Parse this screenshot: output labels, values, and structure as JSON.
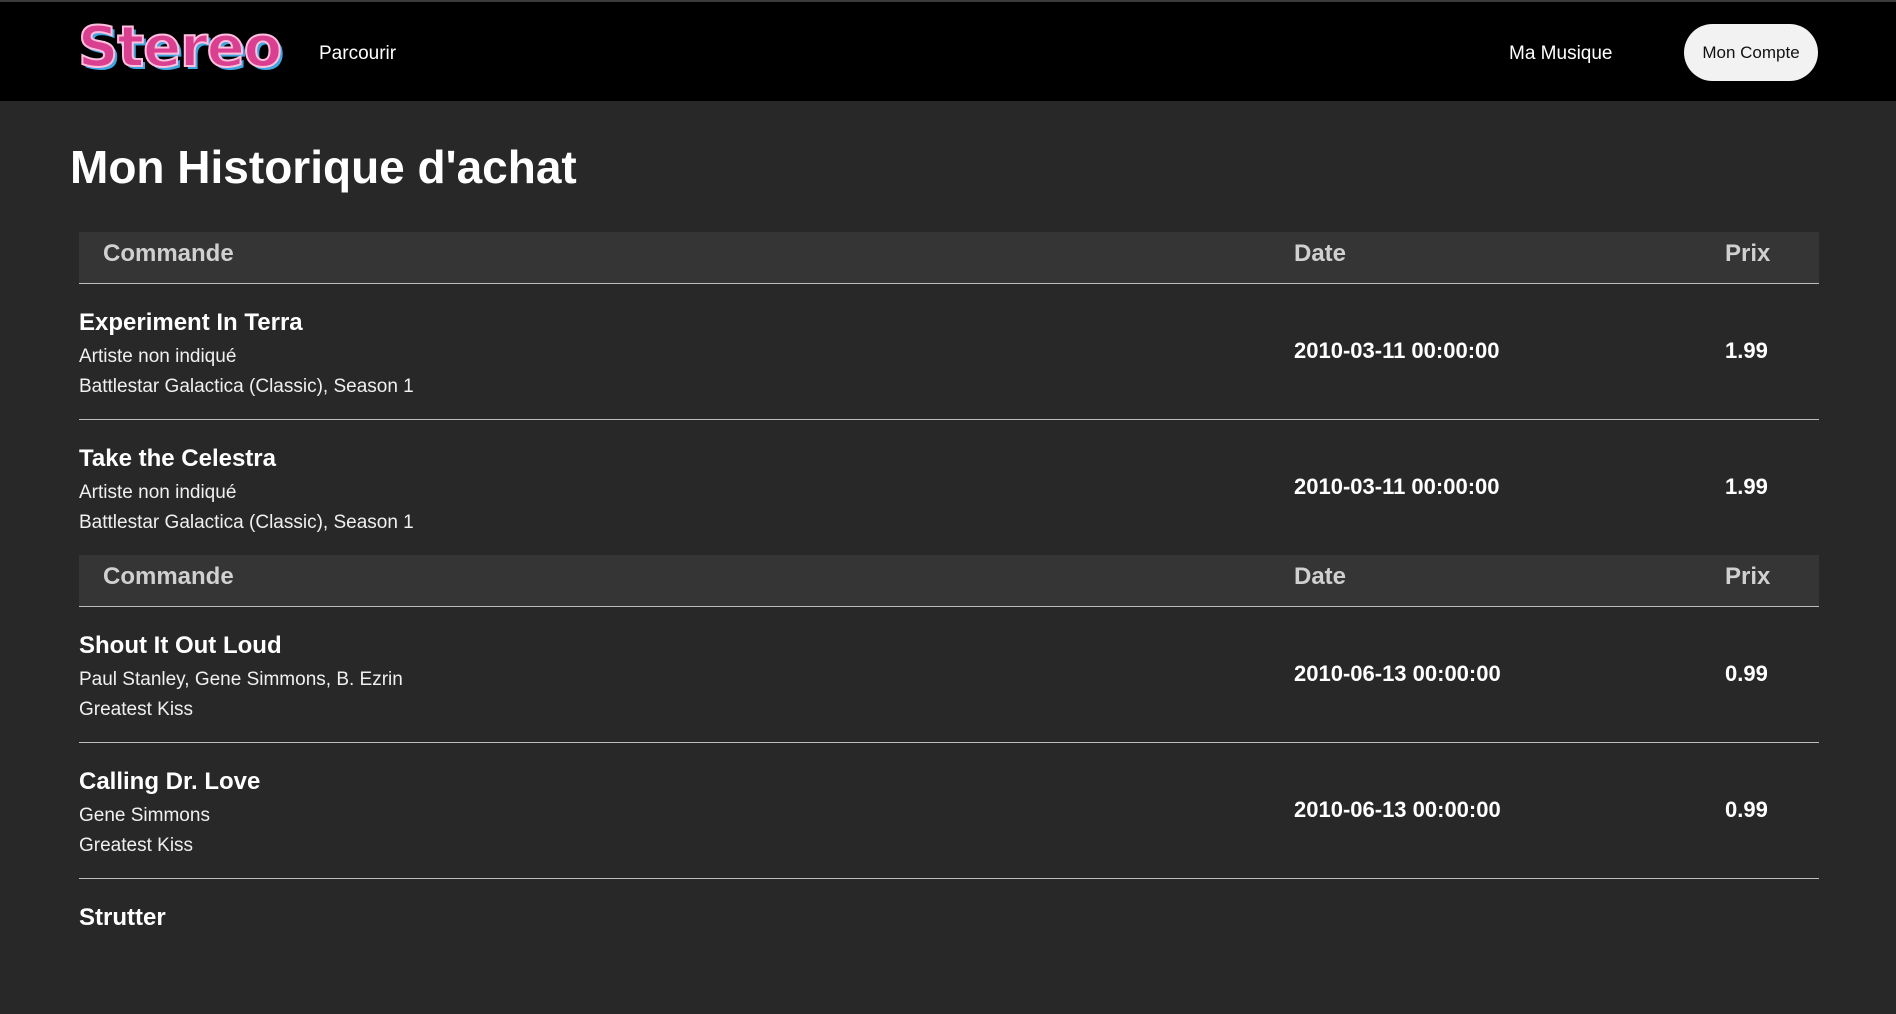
{
  "header": {
    "logo_text": "Stereo",
    "nav_browse": "Parcourir",
    "nav_my_music": "Ma Musique",
    "account_button": "Mon Compte"
  },
  "page": {
    "title": "Mon Historique d'achat"
  },
  "columns": {
    "order": "Commande",
    "date": "Date",
    "price": "Prix"
  },
  "orders": [
    {
      "items": [
        {
          "title": "Experiment In Terra",
          "artist": "Artiste non indiqué",
          "album": "Battlestar Galactica (Classic), Season 1",
          "date": "2010-03-11 00:00:00",
          "price": "1.99"
        },
        {
          "title": "Take the Celestra",
          "artist": "Artiste non indiqué",
          "album": "Battlestar Galactica (Classic), Season 1",
          "date": "2010-03-11 00:00:00",
          "price": "1.99"
        }
      ]
    },
    {
      "items": [
        {
          "title": "Shout It Out Loud",
          "artist": "Paul Stanley, Gene Simmons, B. Ezrin",
          "album": "Greatest Kiss",
          "date": "2010-06-13 00:00:00",
          "price": "0.99"
        },
        {
          "title": "Calling Dr. Love",
          "artist": "Gene Simmons",
          "album": "Greatest Kiss",
          "date": "2010-06-13 00:00:00",
          "price": "0.99"
        },
        {
          "title": "Strutter",
          "artist": "",
          "album": "",
          "date": "",
          "price": ""
        }
      ]
    }
  ],
  "colors": {
    "background": "#282828",
    "navbar": "#000000",
    "table_header": "#353535",
    "logo_pink": "#d9408f",
    "logo_blue": "#3fa6e0"
  }
}
